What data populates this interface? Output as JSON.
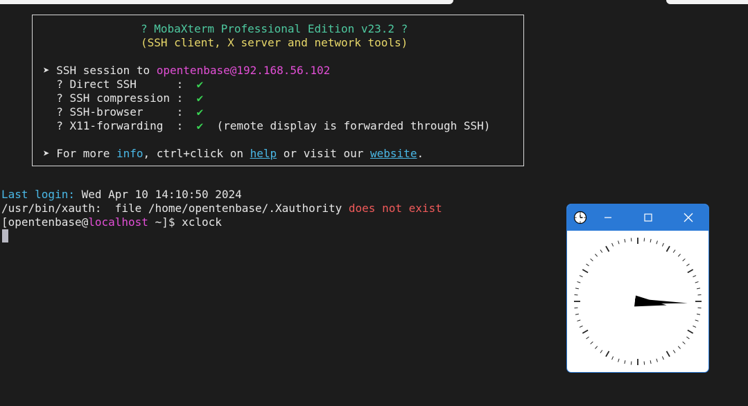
{
  "banner": {
    "title": "? MobaXterm Professional Edition v23.2 ?",
    "subtitle": "(SSH client, X server and network tools)",
    "session_prefix": "➤ SSH session to ",
    "session_target": "opentenbase@192.168.56.102",
    "features": [
      {
        "label": "  ? Direct SSH      :  ",
        "check": "✔",
        "note": ""
      },
      {
        "label": "  ? SSH compression :  ",
        "check": "✔",
        "note": ""
      },
      {
        "label": "  ? SSH-browser     :  ",
        "check": "✔",
        "note": ""
      },
      {
        "label": "  ? X11-forwarding  :  ",
        "check": "✔",
        "note": "  (remote display is forwarded through SSH)"
      }
    ],
    "more_prefix": "➤ For more ",
    "more_info": "info",
    "more_mid": ", ctrl+click on ",
    "more_help": "help",
    "more_mid2": " or visit our ",
    "more_website": "website",
    "more_end": "."
  },
  "terminal": {
    "last_login_label": "Last login:",
    "last_login_value": " Wed Apr 10 14:10:50 2024",
    "xauth_prefix": "/usr/bin/xauth:  file /home/opentenbase/.Xauthority ",
    "xauth_error": "does not exist",
    "prompt_open": "[opentenbase@",
    "prompt_host": "localhost",
    "prompt_close": " ~]$ ",
    "command": "xclock"
  },
  "xclock": {
    "title_icon": "clock-icon",
    "minimize_glyph": "—",
    "maximize_glyph": "☐",
    "close_glyph": "✕",
    "time_shown": "3:15"
  },
  "colors": {
    "background": "#1c1c1c",
    "title_green": "#4ec9a0",
    "subtitle_yellow": "#e8d86a",
    "host_magenta": "#e24fd6",
    "link_cyan": "#4ab8e6",
    "check_green": "#39d353",
    "error_red": "#f05a5a",
    "window_blue": "#2a79d6"
  }
}
